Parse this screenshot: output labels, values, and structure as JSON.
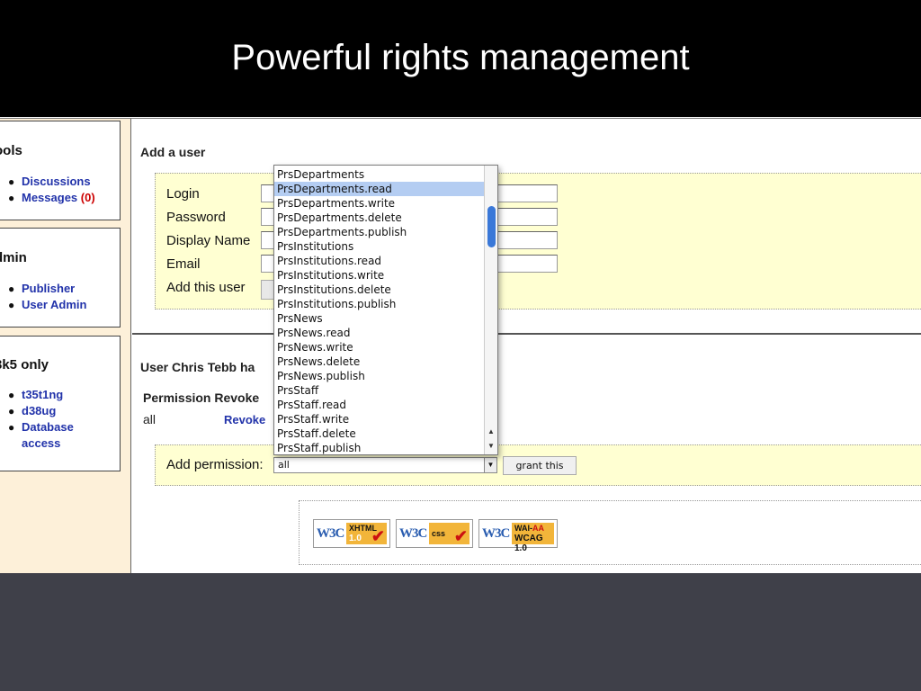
{
  "slide": {
    "title": "Powerful rights management"
  },
  "sidebar": {
    "boxes": [
      {
        "heading": "ools",
        "items": [
          {
            "label": "Discussions"
          },
          {
            "label": "Messages",
            "count": "(0)"
          }
        ]
      },
      {
        "heading": "dmin",
        "items": [
          {
            "label": "Publisher"
          },
          {
            "label": "User Admin"
          }
        ]
      },
      {
        "heading": "3k5 only",
        "items": [
          {
            "label": "t35t1ng"
          },
          {
            "label": "d38ug"
          },
          {
            "label": "Database access"
          }
        ]
      }
    ]
  },
  "add_user": {
    "heading": "Add a user",
    "fields": [
      {
        "label": "Login"
      },
      {
        "label": "Password"
      },
      {
        "label": "Display Name"
      },
      {
        "label": "Email"
      }
    ],
    "submit_label": "Add this user"
  },
  "permissions": {
    "user_heading": "User Chris Tebb ha",
    "table_header": "Permission Revoke",
    "rows": [
      {
        "permission": "all",
        "action": "Revoke"
      }
    ],
    "add_label": "Add permission:",
    "selected_value": "all",
    "grant_label": "grant this",
    "options": [
      "PrsDepartments",
      "PrsDepartments.read",
      "PrsDepartments.write",
      "PrsDepartments.delete",
      "PrsDepartments.publish",
      "PrsInstitutions",
      "PrsInstitutions.read",
      "PrsInstitutions.write",
      "PrsInstitutions.delete",
      "PrsInstitutions.publish",
      "PrsNews",
      "PrsNews.read",
      "PrsNews.write",
      "PrsNews.delete",
      "PrsNews.publish",
      "PrsStaff",
      "PrsStaff.read",
      "PrsStaff.write",
      "PrsStaff.delete",
      "PrsStaff.publish"
    ],
    "highlighted_option": "PrsDepartments.read"
  },
  "badges": [
    {
      "mark": "W3C",
      "top": "XHTML",
      "bottom": "1.0"
    },
    {
      "mark": "W3C",
      "top": "css",
      "bottom": ""
    },
    {
      "mark": "W3C",
      "top": "WAI-",
      "top_accent": "AA",
      "bottom": "WCAG 1.0"
    }
  ],
  "colors": {
    "title_bar": "#000000",
    "sidebar_bg": "#fdf0d9",
    "panel_bg": "#ffffd2",
    "link": "#2233aa",
    "highlight": "#b4cdf2",
    "slide_bg": "#3f4049"
  }
}
